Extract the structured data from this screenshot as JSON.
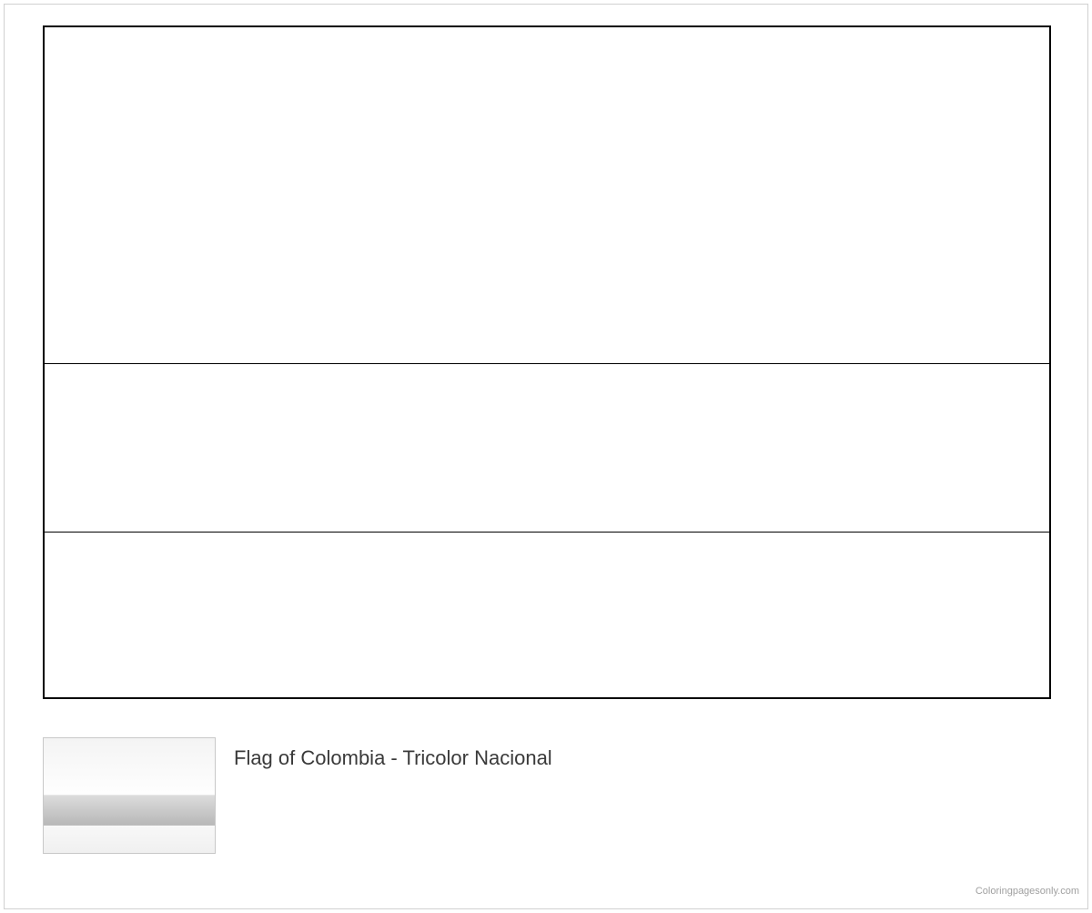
{
  "caption": "Flag of Colombia - Tricolor Nacional",
  "watermark": "Coloringpagesonly.com",
  "flag": {
    "stripes": [
      {
        "name": "yellow",
        "proportion": 0.5
      },
      {
        "name": "blue",
        "proportion": 0.25
      },
      {
        "name": "red",
        "proportion": 0.25
      }
    ]
  }
}
